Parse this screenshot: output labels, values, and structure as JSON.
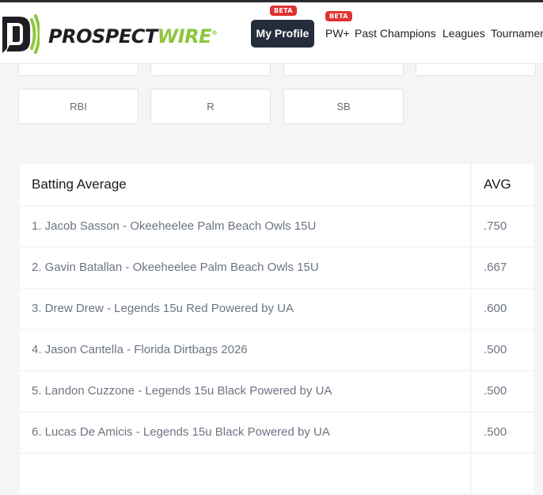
{
  "brand": {
    "name_part1": "PROSPECT",
    "name_part2": "WIRE",
    "registered": "®"
  },
  "nav": {
    "my_profile": {
      "label": "My Profile",
      "badge": "BETA"
    },
    "pw_plus": {
      "label": "PW+",
      "badge": "BETA"
    },
    "links": [
      "Past Champions",
      "Leagues",
      "Tournamen"
    ]
  },
  "stat_buttons": [
    "RBI",
    "R",
    "SB"
  ],
  "leaderboard": {
    "title": "Batting Average",
    "stat_header": "AVG",
    "rows": [
      {
        "player": "1. Jacob Sasson - Okeeheelee Palm Beach Owls 15U",
        "value": ".750"
      },
      {
        "player": "2. Gavin Batallan - Okeeheelee Palm Beach Owls 15U",
        "value": ".667"
      },
      {
        "player": "3. Drew Drew - Legends 15u Red Powered by UA",
        "value": ".600"
      },
      {
        "player": "4. Jason Cantella - Florida Dirtbags 2026",
        "value": ".500"
      },
      {
        "player": "5. Landon Cuzzone - Legends 15u Black Powered by UA",
        "value": ".500"
      },
      {
        "player": "6. Lucas De Amicis - Legends 15u Black Powered by UA",
        "value": ".500"
      }
    ]
  },
  "colors": {
    "accent_green": "#8ec63f",
    "badge_red": "#e03131",
    "profile_button": "#252c3b",
    "page_bg": "#f5f5f5"
  }
}
